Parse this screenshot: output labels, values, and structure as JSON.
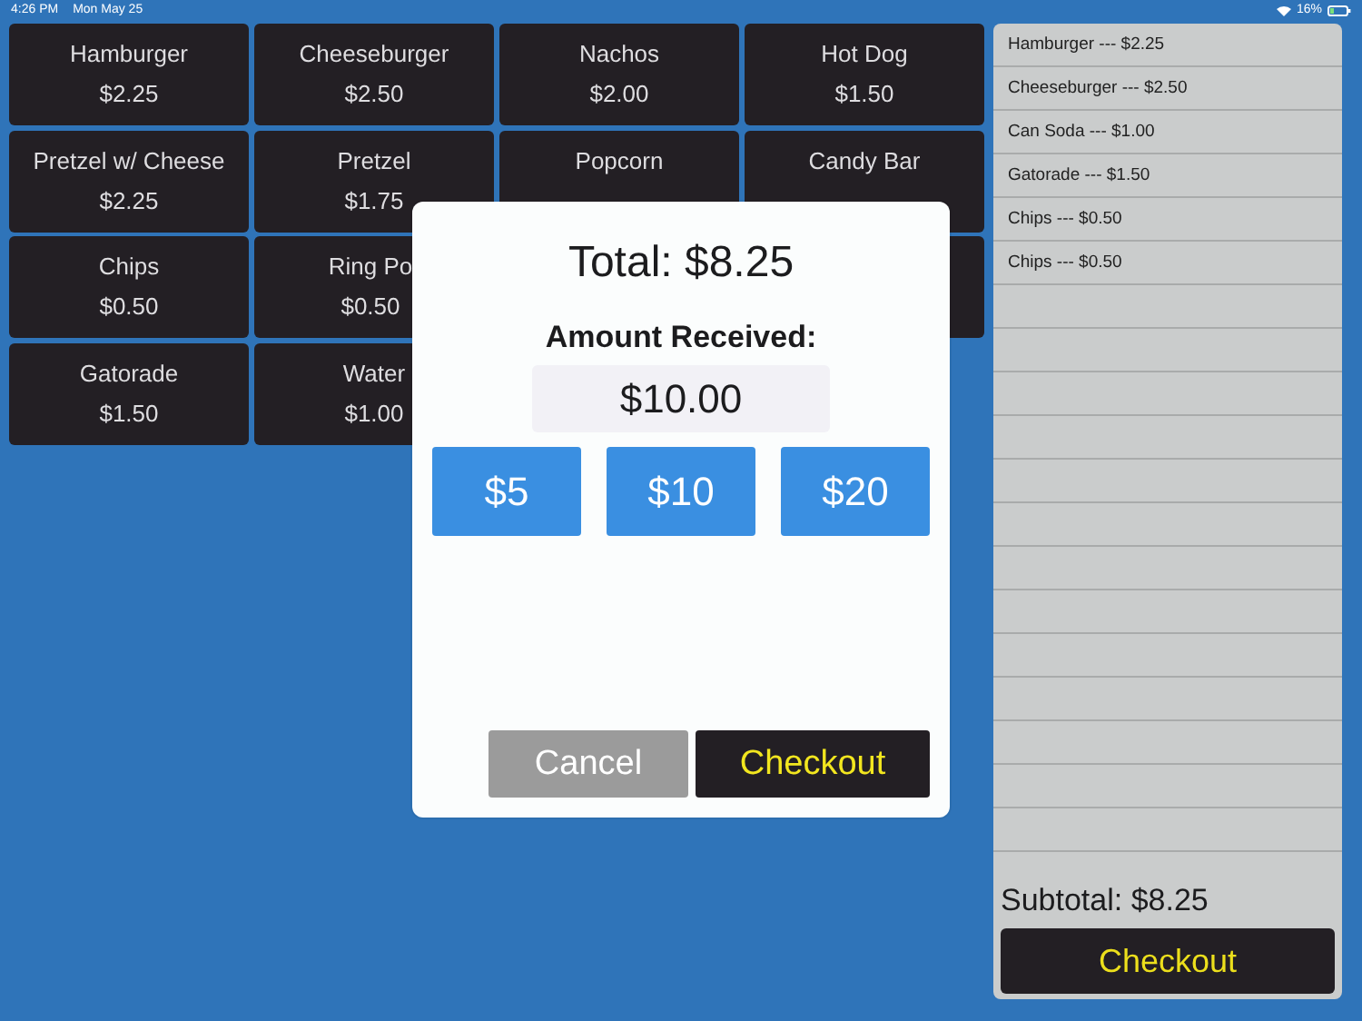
{
  "status_bar": {
    "time": "4:26 PM",
    "date": "Mon May 25",
    "battery": "16%"
  },
  "menu_items": [
    {
      "kind": "item",
      "name": "Hamburger",
      "price": "$2.25"
    },
    {
      "kind": "item",
      "name": "Cheeseburger",
      "price": "$2.50"
    },
    {
      "kind": "item",
      "name": "Nachos",
      "price": "$2.00"
    },
    {
      "kind": "item",
      "name": "Hot Dog",
      "price": "$1.50"
    },
    {
      "kind": "item",
      "name": "Pretzel w/ Cheese",
      "price": "$2.25"
    },
    {
      "kind": "item",
      "name": "Pretzel",
      "price": "$1.75"
    },
    {
      "kind": "item",
      "name": "Popcorn"
    },
    {
      "kind": "item",
      "name": "Candy Bar"
    },
    {
      "kind": "item",
      "name": "Chips",
      "price": "$0.50"
    },
    {
      "kind": "clipped",
      "name": "Ring Po",
      "price": "$0.50"
    },
    {
      "kind": "hidden"
    },
    {
      "kind": "covered"
    },
    {
      "kind": "item",
      "name": "Gatorade",
      "price": "$1.50"
    },
    {
      "kind": "item",
      "name": "Water",
      "price": "$1.00"
    }
  ],
  "order": {
    "lines": [
      "Hamburger --- $2.25",
      "Cheeseburger --- $2.50",
      "Can Soda --- $1.00",
      "Gatorade --- $1.50",
      "Chips --- $0.50",
      "Chips --- $0.50"
    ],
    "subtotal": "Subtotal: $8.25",
    "checkout_button": "Checkout"
  },
  "dialog": {
    "total": "Total: $8.25",
    "amount_label": "Amount Received:",
    "amount_value": "$10.00",
    "quick_amounts": [
      "$5",
      "$10",
      "$20"
    ],
    "buttons": [
      {
        "kind": "cancel",
        "label": "Cancel"
      },
      {
        "kind": "confirm",
        "label": "Checkout"
      }
    ]
  }
}
